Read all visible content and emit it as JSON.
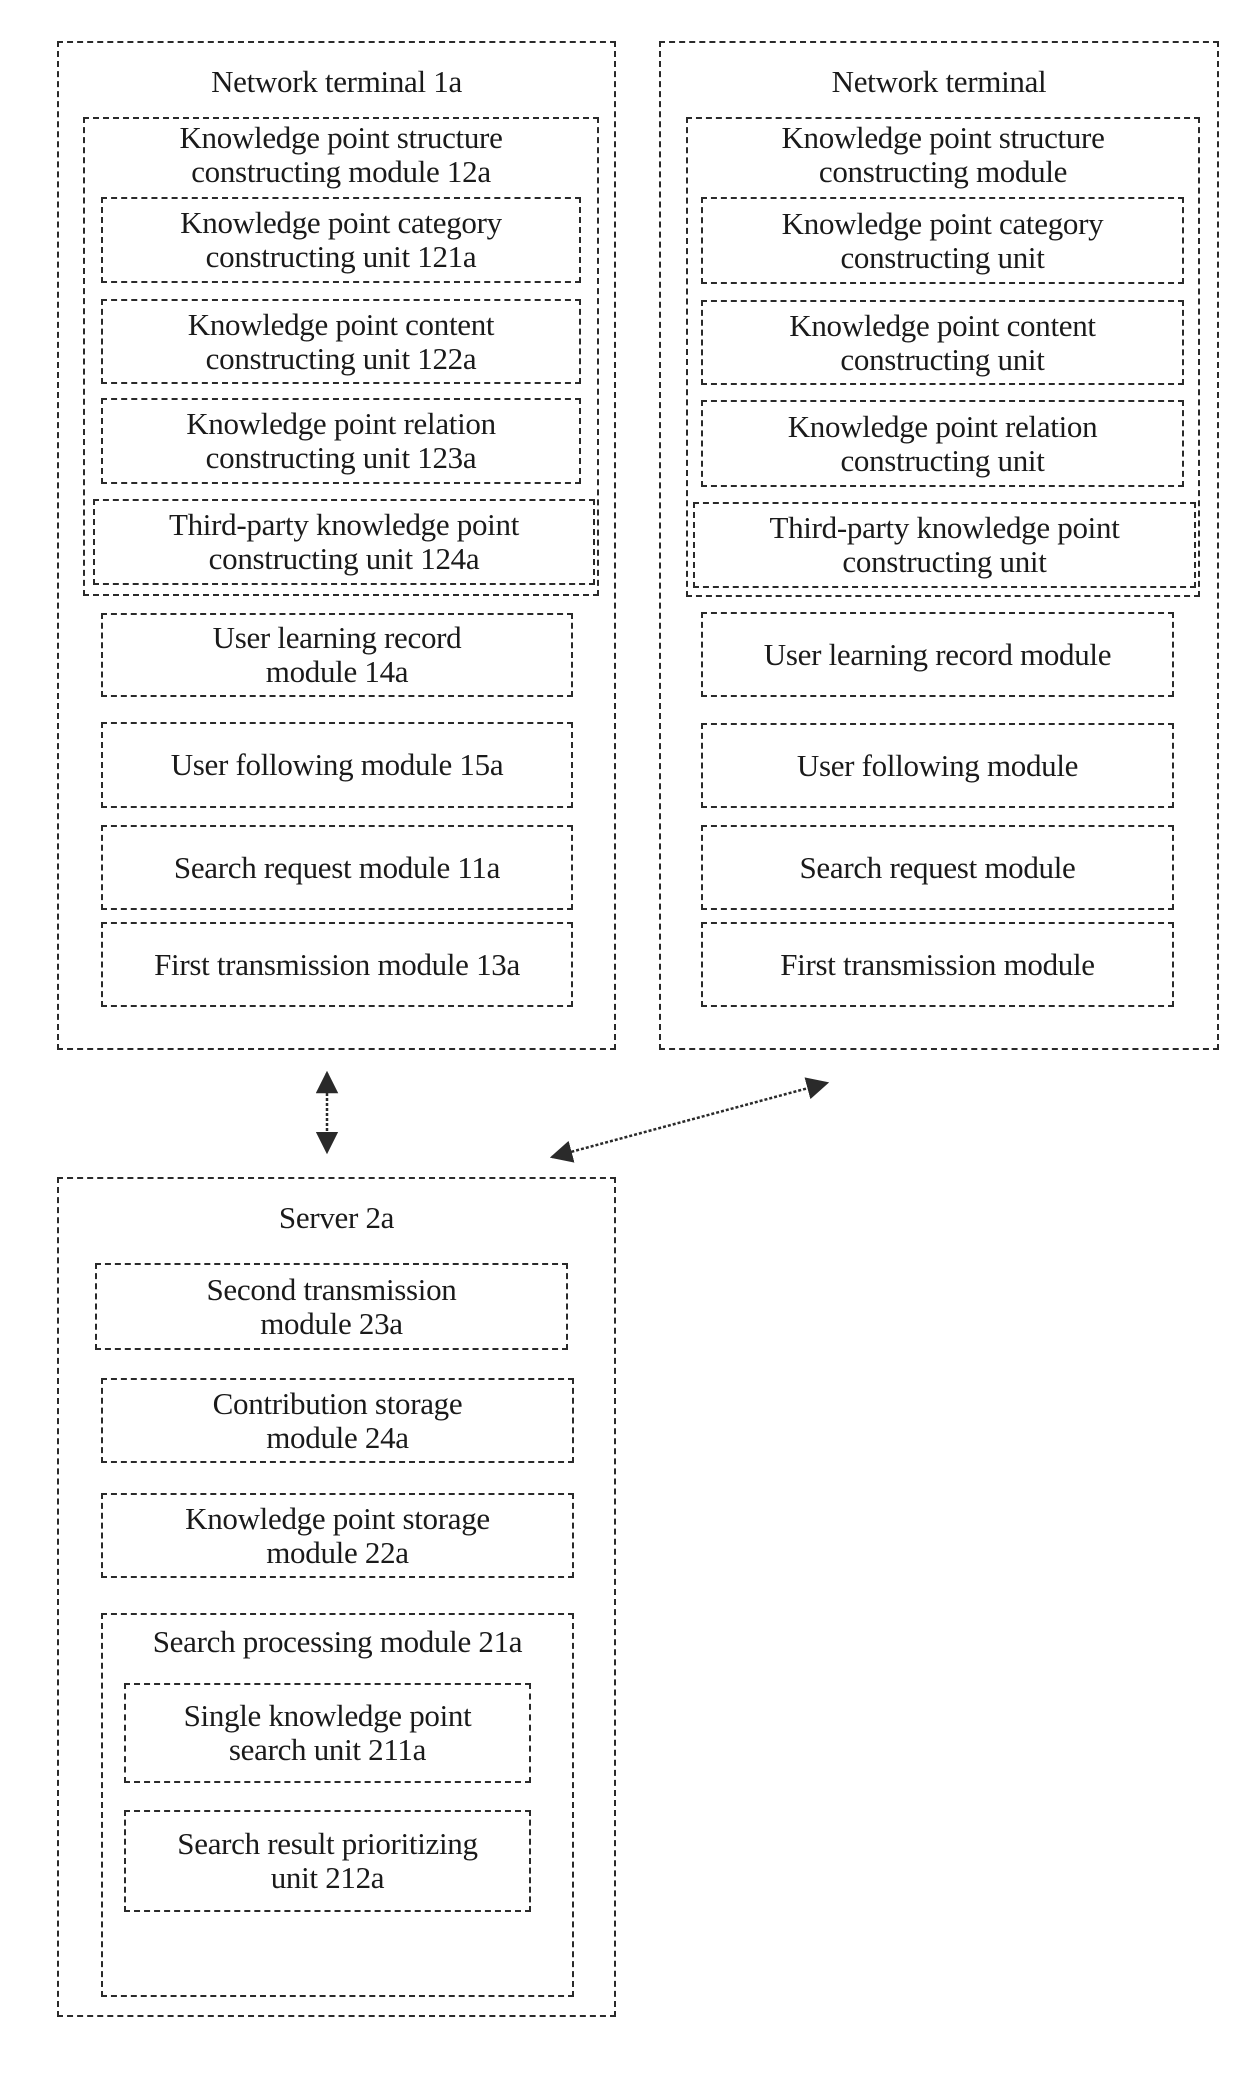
{
  "terminal_1": {
    "title": "Network terminal 1a",
    "structure_module": {
      "title_line1": "Knowledge point structure",
      "title_line2": "constructing module 12a",
      "units": [
        {
          "line1": "Knowledge point category",
          "line2": "constructing unit 121a"
        },
        {
          "line1": "Knowledge point content",
          "line2": "constructing unit 122a"
        },
        {
          "line1": "Knowledge point relation",
          "line2": "constructing unit 123a"
        },
        {
          "line1": "Third-party knowledge point",
          "line2": "constructing unit 124a"
        }
      ]
    },
    "modules": [
      {
        "line1": "User learning record",
        "line2": "module 14a"
      },
      {
        "line1": "User following module 15a",
        "line2": ""
      },
      {
        "line1": "Search request module 11a",
        "line2": ""
      },
      {
        "line1": "First transmission module 13a",
        "line2": ""
      }
    ]
  },
  "terminal_2": {
    "title": "Network terminal",
    "structure_module": {
      "title_line1": "Knowledge point structure",
      "title_line2": "constructing module",
      "units": [
        {
          "line1": "Knowledge point category",
          "line2": "constructing unit"
        },
        {
          "line1": "Knowledge point content",
          "line2": "constructing unit"
        },
        {
          "line1": "Knowledge point relation",
          "line2": "constructing unit"
        },
        {
          "line1": "Third-party knowledge point",
          "line2": "constructing unit"
        }
      ]
    },
    "modules": [
      {
        "line1": "User learning record module",
        "line2": ""
      },
      {
        "line1": "User following module",
        "line2": ""
      },
      {
        "line1": "Search request module",
        "line2": ""
      },
      {
        "line1": "First transmission module",
        "line2": ""
      }
    ]
  },
  "server": {
    "title": "Server 2a",
    "modules": [
      {
        "line1": "Second transmission",
        "line2": "module 23a"
      },
      {
        "line1": "Contribution storage",
        "line2": "module 24a"
      },
      {
        "line1": "Knowledge point storage",
        "line2": "module 22a"
      }
    ],
    "search_processing": {
      "title": "Search processing module 21a",
      "units": [
        {
          "line1": "Single knowledge point",
          "line2": "search unit 211a"
        },
        {
          "line1": "Search result prioritizing",
          "line2": "unit 212a"
        }
      ]
    }
  },
  "connections": [
    {
      "from": "terminal_1",
      "to": "server",
      "type": "bidirectional"
    },
    {
      "from": "terminal_2",
      "to": "server",
      "type": "bidirectional"
    }
  ],
  "colors": {
    "stroke": "#2a2a2a",
    "background": "#ffffff"
  }
}
